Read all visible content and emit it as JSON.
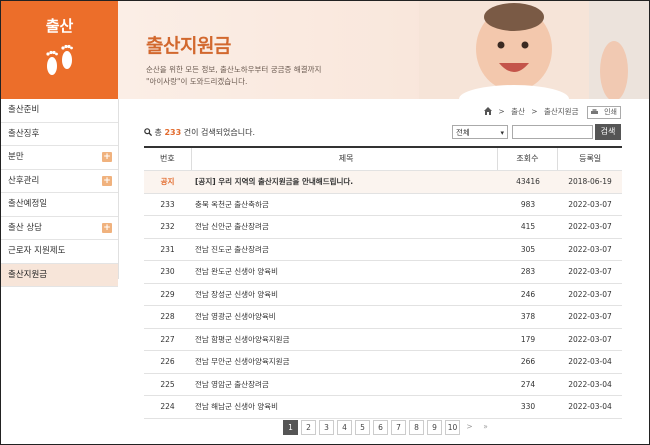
{
  "sidebar": {
    "title": "출산",
    "items": [
      {
        "label": "출산준비",
        "plus": false,
        "active": false
      },
      {
        "label": "출산징후",
        "plus": false,
        "active": false
      },
      {
        "label": "분만",
        "plus": true,
        "active": false
      },
      {
        "label": "산후관리",
        "plus": true,
        "active": false
      },
      {
        "label": "출산예정일",
        "plus": false,
        "active": false
      },
      {
        "label": "출산 상담",
        "plus": true,
        "active": false
      },
      {
        "label": "근로자 지원제도",
        "plus": false,
        "active": false
      },
      {
        "label": "출산지원금",
        "plus": false,
        "active": true
      }
    ],
    "plus_icon": "+"
  },
  "banner": {
    "title": "출산지원금",
    "desc_line1": "순산을 위한 모든 정보, 출산노하우부터 궁금증 해결까지",
    "desc_line2": "\"아이사랑\"이 도와드리겠습니다."
  },
  "breadcrumb": {
    "home_icon": "home-icon",
    "sep": ">",
    "level1": "출산",
    "level2": "출산지원금",
    "print_label": "인쇄"
  },
  "search": {
    "count_prefix": "총",
    "count": "233",
    "count_suffix": "건이 검색되었습니다.",
    "select_value": "전체",
    "input_value": "",
    "button_label": "검색"
  },
  "table": {
    "headers": [
      "번호",
      "제목",
      "조회수",
      "등록일"
    ],
    "notice": {
      "num": "공지",
      "title": "[공지] 우리 지역의 출산지원금을 안내해드립니다.",
      "views": "43416",
      "date": "2018-06-19"
    },
    "rows": [
      {
        "num": "233",
        "title": "충북 옥천군 출산축하금",
        "views": "983",
        "date": "2022-03-07"
      },
      {
        "num": "232",
        "title": "전남 신안군 출산장려금",
        "views": "415",
        "date": "2022-03-07"
      },
      {
        "num": "231",
        "title": "전남 진도군 출산장려금",
        "views": "305",
        "date": "2022-03-07"
      },
      {
        "num": "230",
        "title": "전남 완도군 신생아 양육비",
        "views": "283",
        "date": "2022-03-07"
      },
      {
        "num": "229",
        "title": "전남 장성군 신생아 양육비",
        "views": "246",
        "date": "2022-03-07"
      },
      {
        "num": "228",
        "title": "전남 영광군 신생아양육비",
        "views": "378",
        "date": "2022-03-07"
      },
      {
        "num": "227",
        "title": "전남 함평군 신생아양육지원금",
        "views": "179",
        "date": "2022-03-07"
      },
      {
        "num": "226",
        "title": "전남 무안군 신생아양육지원금",
        "views": "266",
        "date": "2022-03-04"
      },
      {
        "num": "225",
        "title": "전남 영암군 출산장려금",
        "views": "274",
        "date": "2022-03-04"
      },
      {
        "num": "224",
        "title": "전남 해남군 신생아 양육비",
        "views": "330",
        "date": "2022-03-04"
      }
    ]
  },
  "pagination": {
    "pages": [
      "1",
      "2",
      "3",
      "4",
      "5",
      "6",
      "7",
      "8",
      "9",
      "10"
    ],
    "current": "1",
    "next": ">",
    "last": "»"
  },
  "colors": {
    "accent": "#ec6e2a",
    "active_bg": "#f7e5d9"
  }
}
